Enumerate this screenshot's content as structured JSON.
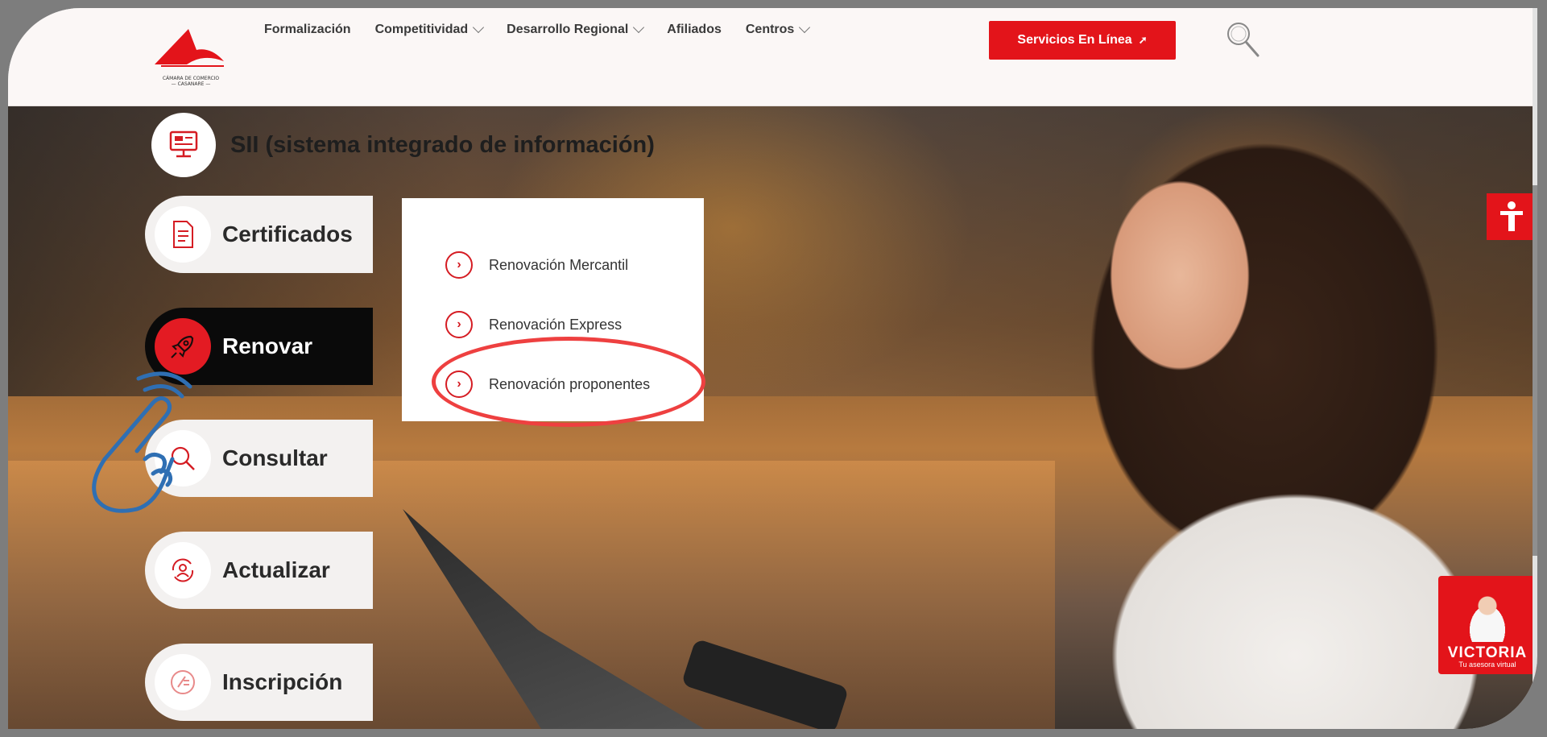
{
  "header": {
    "logo_caption": "CÁMARA DE COMERCIO\n— CASANARE —",
    "nav": [
      {
        "label": "Formalización",
        "has_dropdown": false
      },
      {
        "label": "Competitividad",
        "has_dropdown": true
      },
      {
        "label": "Desarrollo Regional",
        "has_dropdown": true
      },
      {
        "label": "Afiliados",
        "has_dropdown": false
      },
      {
        "label": "Centros",
        "has_dropdown": true
      }
    ],
    "cta_label": "Servicios En Línea",
    "cta_icon": "external-arrow-icon",
    "search_icon": "search-icon"
  },
  "sii": {
    "title": "SII (sistema integrado de información)",
    "icon": "computer-monitor-icon"
  },
  "menu": [
    {
      "label": "Certificados",
      "icon": "document-icon",
      "active": false
    },
    {
      "label": "Renovar",
      "icon": "rocket-icon",
      "active": true
    },
    {
      "label": "Consultar",
      "icon": "magnifier-icon",
      "active": false
    },
    {
      "label": "Actualizar",
      "icon": "refresh-user-icon",
      "active": false
    },
    {
      "label": "Inscripción",
      "icon": "form-edit-icon",
      "active": false
    }
  ],
  "submenu": [
    {
      "label": "Renovación Mercantil",
      "icon": "chevron-right-circle-icon"
    },
    {
      "label": "Renovación Express",
      "icon": "chevron-right-circle-icon"
    },
    {
      "label": "Renovación proponentes",
      "icon": "chevron-right-circle-icon",
      "highlighted": true
    }
  ],
  "floating": {
    "accessibility_icon": "accessibility-person-icon",
    "assistant_name": "VICTORIA",
    "assistant_subtitle": "Tu asesora virtual"
  },
  "colors": {
    "brand_red": "#e3141a",
    "highlight_red": "#ee4040",
    "hand_blue": "#2f6fb3",
    "active_menu_bg": "#0a0a0a"
  }
}
